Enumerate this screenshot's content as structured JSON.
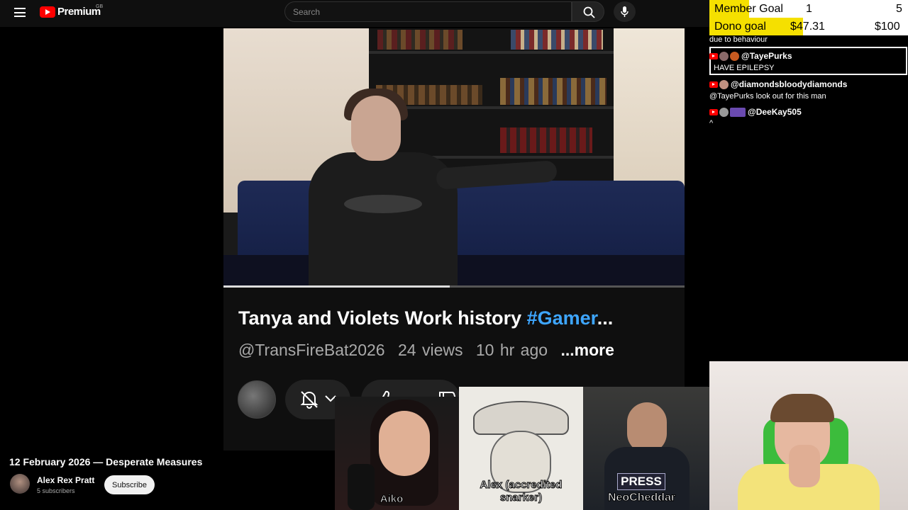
{
  "header": {
    "logo_text": "Premium",
    "logo_region": "GB",
    "search_placeholder": "Search",
    "icons": [
      "menu-icon",
      "search-icon",
      "microphone-icon"
    ]
  },
  "video": {
    "progress_fraction": 0.49,
    "title_main": "Tanya and Violets Work history ",
    "title_hashtag": "#Gamer",
    "title_ellipsis": "...",
    "channel_handle": "@TransFireBat2026",
    "views": "24 views",
    "age": "10 hr ago",
    "more_label": "...more",
    "action_icons": [
      "notification-off-icon",
      "chevron-down-icon",
      "like-icon",
      "dislike-icon"
    ]
  },
  "stream_card": {
    "title": "12 February 2026 — Desperate Measures",
    "host_name": "Alex Rex Pratt",
    "host_subscribers": "5 subscribers",
    "subscribe_label": "Subscribe"
  },
  "goals": {
    "member": {
      "label": "Member Goal",
      "current": "1",
      "target": "5",
      "fill_fraction": 0.2
    },
    "dono": {
      "label": "Dono goal",
      "current": "$47.31",
      "target": "$100",
      "fill_fraction": 0.47
    },
    "fill_color": "#f5e000"
  },
  "chat": {
    "lines": [
      {
        "text": "due to behaviour"
      },
      {
        "author": "@TayePurks",
        "message": "I HAVE EPILEPSY"
      },
      {
        "author": "@diamondsbloodydiamonds",
        "message": "@TayePurks look out for this man"
      },
      {
        "author": "@DeeKay505",
        "message": "^"
      }
    ]
  },
  "webcams": [
    {
      "label": "Aiko"
    },
    {
      "label": "Alex (accredited snarker)"
    },
    {
      "label": "NeoCheddar",
      "badge": "PRESS"
    }
  ]
}
